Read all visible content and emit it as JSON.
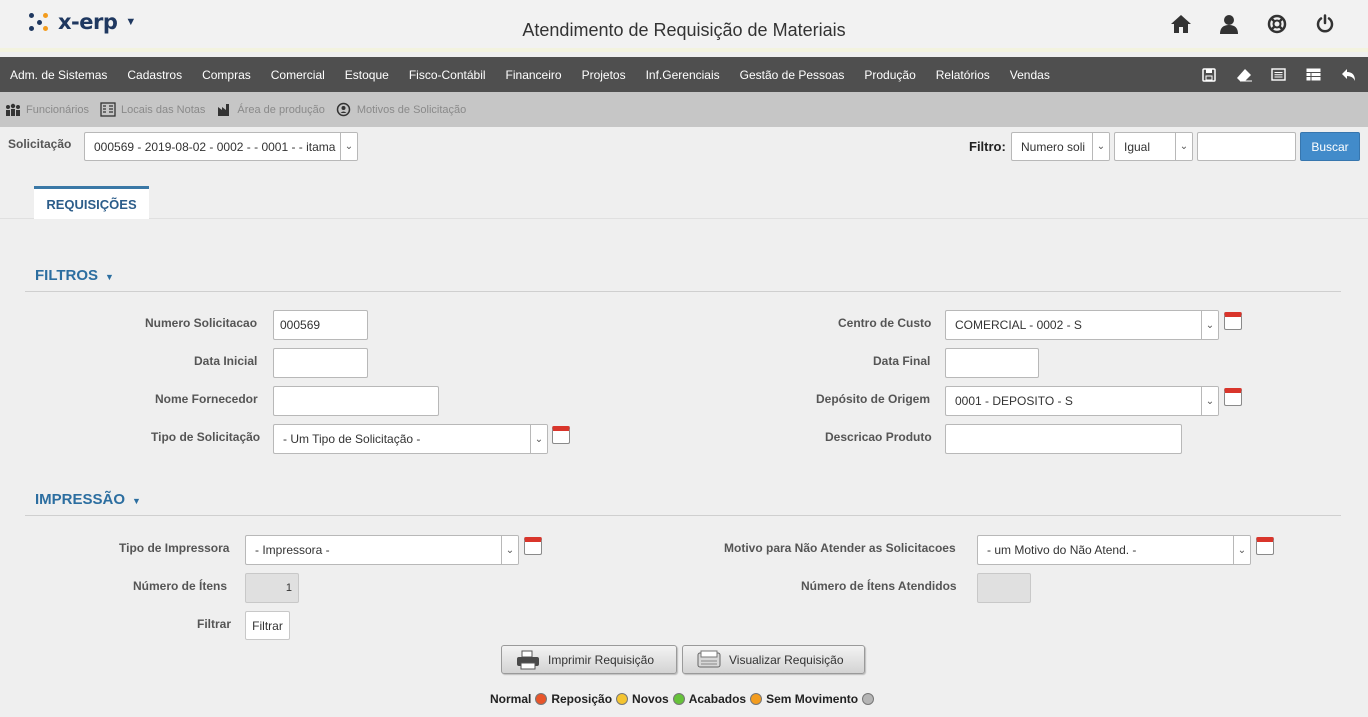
{
  "app": {
    "logo_text": "x-erp",
    "title": "Atendimento de Requisição de Materiais",
    "top_icons": [
      "home-icon",
      "user-icon",
      "lifebuoy-icon",
      "power-icon"
    ]
  },
  "menu": {
    "items": [
      "Adm. de Sistemas",
      "Cadastros",
      "Compras",
      "Comercial",
      "Estoque",
      "Fisco-Contábil",
      "Financeiro",
      "Projetos",
      "Inf.Gerenciais",
      "Gestão de Pessoas",
      "Produção",
      "Relatórios",
      "Vendas"
    ],
    "tools": [
      "save-icon",
      "eraser-icon",
      "list-icon",
      "table-icon",
      "undo-icon"
    ]
  },
  "subbar": {
    "items": [
      {
        "label": "Funcionários",
        "icon": "people-icon"
      },
      {
        "label": "Locais das Notas",
        "icon": "building-icon"
      },
      {
        "label": "Área de produção",
        "icon": "factory-icon"
      },
      {
        "label": "Motivos de Solicitação",
        "icon": "badge-icon"
      }
    ]
  },
  "header_form": {
    "solicitacao_label": "Solicitação",
    "solicitacao_value": "000569 - 2019-08-02 - 0002 - - 0001 - - itama",
    "filtro_label": "Filtro:",
    "filtro_field": "Numero soli",
    "filtro_op": "Igual",
    "filtro_value": "",
    "buscar_label": "Buscar"
  },
  "tabs": {
    "active": "REQUISIÇÕES"
  },
  "filtros": {
    "title": "FILTROS",
    "numero_solicitacao_label": "Numero Solicitacao",
    "numero_solicitacao_value": "000569",
    "data_inicial_label": "Data Inicial",
    "data_inicial_value": "",
    "nome_fornecedor_label": "Nome Fornecedor",
    "nome_fornecedor_value": "",
    "tipo_solicitacao_label": "Tipo de Solicitação",
    "tipo_solicitacao_value": "- Um Tipo de Solicitação -",
    "centro_custo_label": "Centro de Custo",
    "centro_custo_value": "COMERCIAL - 0002 - S",
    "data_final_label": "Data Final",
    "data_final_value": "",
    "deposito_origem_label": "Depósito de Origem",
    "deposito_origem_value": "0001 - DEPOSITO - S",
    "descricao_produto_label": "Descricao Produto",
    "descricao_produto_value": ""
  },
  "impressao": {
    "title": "IMPRESSÃO",
    "tipo_impressora_label": "Tipo de Impressora",
    "tipo_impressora_value": "- Impressora -",
    "numero_itens_label": "Número de Ítens",
    "numero_itens_value": "1",
    "filtrar_label": "Filtrar",
    "filtrar_button": "Filtrar",
    "motivo_label": "Motivo para Não Atender as Solicitacoes",
    "motivo_value": "- um Motivo do Não Atend. -",
    "numero_itens_atendidos_label": "Número de Ítens Atendidos",
    "numero_itens_atendidos_value": ""
  },
  "actions": {
    "imprimir": "Imprimir Requisição",
    "visualizar": "Visualizar Requisição"
  },
  "legend": [
    {
      "label": "Normal",
      "color": "#e8552a"
    },
    {
      "label": "Reposição",
      "color": "#f4c430"
    },
    {
      "label": "Novos",
      "color": "#66c23a"
    },
    {
      "label": "Acabados",
      "color": "#f39c1e"
    },
    {
      "label": "Sem Movimento",
      "color": "#b5b5b5"
    }
  ]
}
